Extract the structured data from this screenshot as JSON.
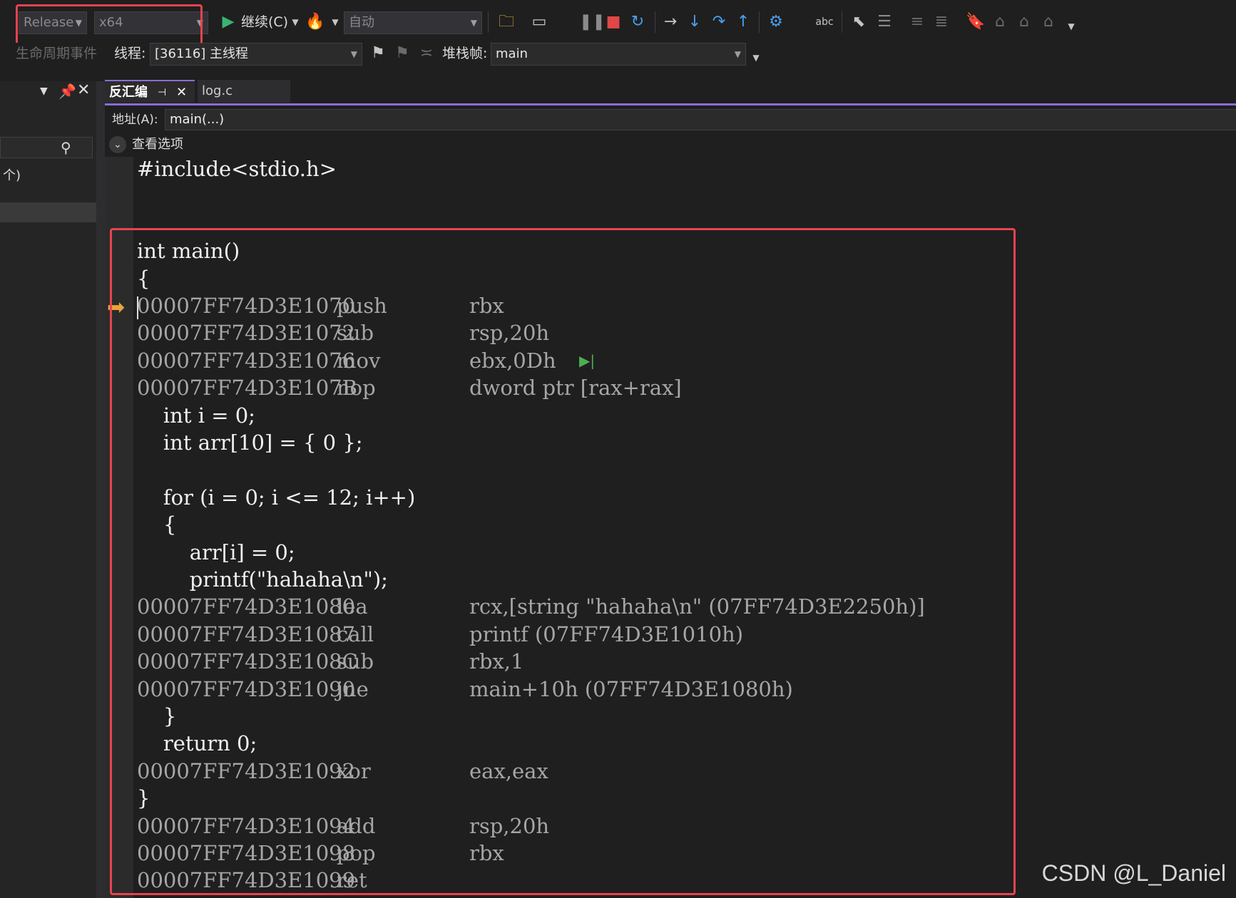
{
  "toolbar": {
    "config_label": "Release",
    "platform_label": "x64",
    "continue_label": "继续(C)",
    "auto_label": "自动",
    "lifecycle_label": "生命周期事件",
    "thread_caption": "线程:",
    "thread_value": "[36116] 主线程",
    "stackframe_caption": "堆栈帧:",
    "stackframe_value": "main"
  },
  "left_panel": {
    "partial_text": "个)"
  },
  "tabs": [
    {
      "label": "反汇编"
    },
    {
      "label": "log.c"
    }
  ],
  "address_bar": {
    "label": "地址(A):",
    "value": "main(...)"
  },
  "view_options_label": "查看选项",
  "disassembly": [
    {
      "source": "#include<stdio.h>"
    },
    {
      "source": ""
    },
    {
      "source": ""
    },
    {
      "source": "int main()"
    },
    {
      "source": "{"
    },
    {
      "address": "00007FF74D3E1070",
      "mnemonic": "push",
      "operands": "rbx"
    },
    {
      "address": "00007FF74D3E1072",
      "mnemonic": "sub",
      "operands": "rsp,20h"
    },
    {
      "address": "00007FF74D3E1076",
      "mnemonic": "mov",
      "operands": "ebx,0Dh"
    },
    {
      "address": "00007FF74D3E107B",
      "mnemonic": "nop",
      "operands": "dword ptr [rax+rax]"
    },
    {
      "source": "    int i = 0;"
    },
    {
      "source": "    int arr[10] = { 0 };"
    },
    {
      "source": ""
    },
    {
      "source": "    for (i = 0; i <= 12; i++)"
    },
    {
      "source": "    {"
    },
    {
      "source": "        arr[i] = 0;"
    },
    {
      "source": "        printf(\"hahaha\\n\");"
    },
    {
      "address": "00007FF74D3E1080",
      "mnemonic": "lea",
      "operands": "rcx,[string \"hahaha\\n\" (07FF74D3E2250h)]"
    },
    {
      "address": "00007FF74D3E1087",
      "mnemonic": "call",
      "operands": "printf (07FF74D3E1010h)"
    },
    {
      "address": "00007FF74D3E108C",
      "mnemonic": "sub",
      "operands": "rbx,1"
    },
    {
      "address": "00007FF74D3E1090",
      "mnemonic": "jne",
      "operands": "main+10h (07FF74D3E1080h)"
    },
    {
      "source": "    }"
    },
    {
      "source": "    return 0;"
    },
    {
      "address": "00007FF74D3E1092",
      "mnemonic": "xor",
      "operands": "eax,eax"
    },
    {
      "source": "}"
    },
    {
      "address": "00007FF74D3E1094",
      "mnemonic": "add",
      "operands": "rsp,20h"
    },
    {
      "address": "00007FF74D3E1098",
      "mnemonic": "pop",
      "operands": "rbx"
    },
    {
      "address": "00007FF74D3E1099",
      "mnemonic": "ret",
      "operands": ""
    }
  ],
  "watermark": "CSDN @L_Daniel",
  "colors": {
    "highlight_box": "#e8434f",
    "tab_accent": "#8a6dd8",
    "ip_arrow": "#e8a33a"
  }
}
